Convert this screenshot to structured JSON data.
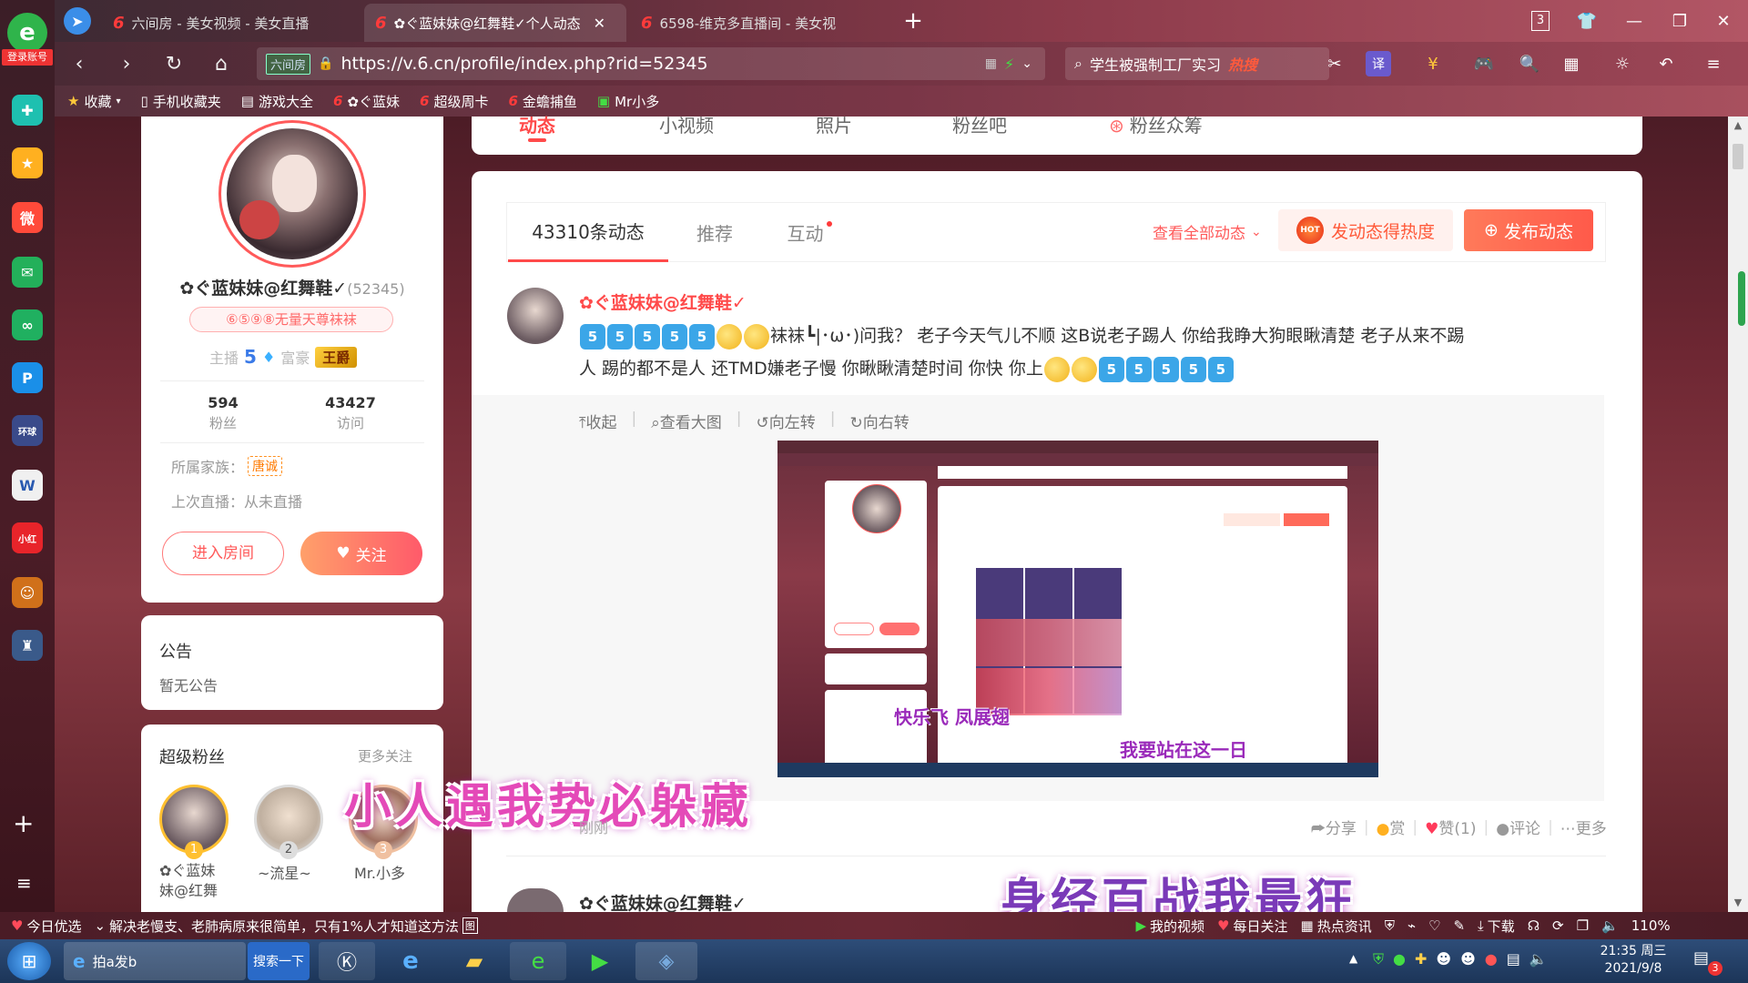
{
  "browser": {
    "tabs": [
      {
        "label": "六间房 - 美女视频 - 美女直播"
      },
      {
        "label": "✿ぐ蓝妹妹@红舞鞋✓个人动态"
      },
      {
        "label": "6598-维克多直播间 - 美女视"
      }
    ],
    "tab_counter": "3",
    "url": "https://v.6.cn/profile/index.php?rid=52345",
    "site_badge": "六间房",
    "search_text": "学生被强制工厂实习",
    "search_hot": "热搜",
    "sidebar_login": "登录账号",
    "bookmarks": [
      "收藏",
      "手机收藏夹",
      "游戏大全",
      "✿ぐ蓝妹",
      "超级周卡",
      "金蟾捕鱼",
      "Mr小多"
    ]
  },
  "nav_tabs": [
    "动态",
    "小视频",
    "照片",
    "粉丝吧",
    "粉丝众筹"
  ],
  "profile": {
    "name": "✿ぐ蓝妹妹@红舞鞋✓",
    "rid": "(52345)",
    "badge": "⑥⑤⑨⑧无量天尊袜袜",
    "anchor_label": "主播",
    "anchor_level": "5",
    "rich_label": "富豪",
    "rich_rank": "王爵",
    "fans_count": "594",
    "fans_label": "粉丝",
    "visits_count": "43427",
    "visits_label": "访问",
    "family_label": "所属家族：",
    "family_value": "唐诚",
    "last_live": "上次直播：从未直播",
    "enter_room": "进入房间",
    "follow": "关注"
  },
  "notice": {
    "title": "公告",
    "content": "暂无公告"
  },
  "super_fans": {
    "title": "超级粉丝",
    "more": "更多关注",
    "fans": [
      {
        "rank": "1",
        "name": "✿ぐ蓝妹",
        "name2": "妹@红舞"
      },
      {
        "rank": "2",
        "name": "~流星~"
      },
      {
        "rank": "3",
        "name": "Mr.小多"
      }
    ]
  },
  "feed": {
    "tabs": [
      "43310条动态",
      "推荐",
      "互动"
    ],
    "view_all": "查看全部动态",
    "heat_btn": "发动态得热度",
    "post_btn": "发布动态",
    "post_author": "✿ぐ蓝妹妹@红舞鞋✓",
    "post_line1": "袜袜┗|･ω･)问我？ 老子今天气儿不顺 这B说老子踢人 你给我睁大狗眼瞅清楚 老子从来不踢",
    "post_line2": "人 踢的都不是人 还TMD嫌老子慢 你瞅瞅清楚时间 你快 你上",
    "img_tools": [
      "收起",
      "查看大图",
      "向左转",
      "向右转"
    ],
    "time": "刚刚",
    "actions": [
      "分享",
      "赏",
      "赞(1)",
      "评论",
      "更多"
    ],
    "second_author": "✿ぐ蓝妹妹@红舞鞋✓"
  },
  "overlay_texts": {
    "small1": "快乐飞  凤展翅",
    "small2": "我要站在这一日",
    "big1": "小人遇我势必躲藏",
    "big2": "身经百战我最狂"
  },
  "statusbar": {
    "today": "今日优选",
    "news": "解决老慢支、老肺病原来很简单，只有1%人才知道这方法",
    "my_video": "我的视频",
    "daily": "每日关注",
    "hot_news": "热点资讯",
    "download": "下载",
    "zoom": "110%"
  },
  "taskbar": {
    "app1": "拍a发b",
    "search_btn": "搜索一下",
    "time": "21:35 周三",
    "date": "2021/9/8",
    "badge": "3"
  }
}
